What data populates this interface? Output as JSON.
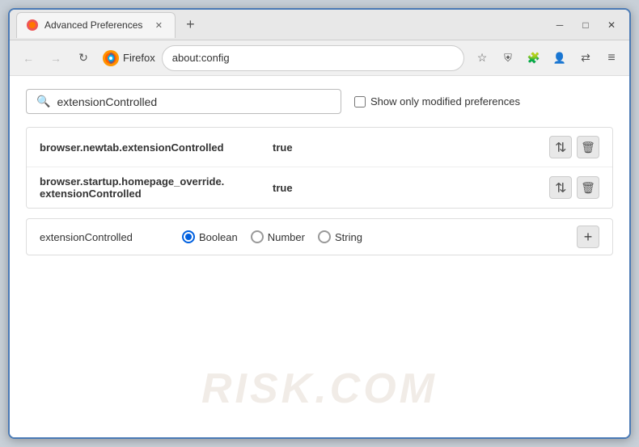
{
  "window": {
    "title": "Advanced Preferences",
    "new_tab_symbol": "+",
    "close_symbol": "✕",
    "minimize_symbol": "─",
    "maximize_symbol": "□"
  },
  "nav": {
    "back_label": "←",
    "forward_label": "→",
    "refresh_label": "↻",
    "firefox_label": "Firefox",
    "url": "about:config",
    "bookmark_icon": "☆",
    "shield_icon": "⛉",
    "ext_icon": "⊞",
    "profile_icon": "⊙",
    "sync_icon": "⇄",
    "menu_icon": "≡"
  },
  "search": {
    "placeholder": "extensionControlled",
    "value": "extensionControlled",
    "checkbox_label": "Show only modified preferences"
  },
  "results": [
    {
      "name": "browser.newtab.extensionControlled",
      "value": "true"
    },
    {
      "name": "browser.startup.homepage_override.\nextensionControlled",
      "name_line1": "browser.startup.homepage_override.",
      "name_line2": "extensionControlled",
      "value": "true",
      "multiline": true
    }
  ],
  "new_pref": {
    "name": "extensionControlled",
    "types": [
      {
        "label": "Boolean",
        "selected": true
      },
      {
        "label": "Number",
        "selected": false
      },
      {
        "label": "String",
        "selected": false
      }
    ],
    "add_label": "+"
  },
  "watermark": "RISK.COM",
  "actions": {
    "toggle_icon": "⇄",
    "delete_icon": "🗑"
  }
}
